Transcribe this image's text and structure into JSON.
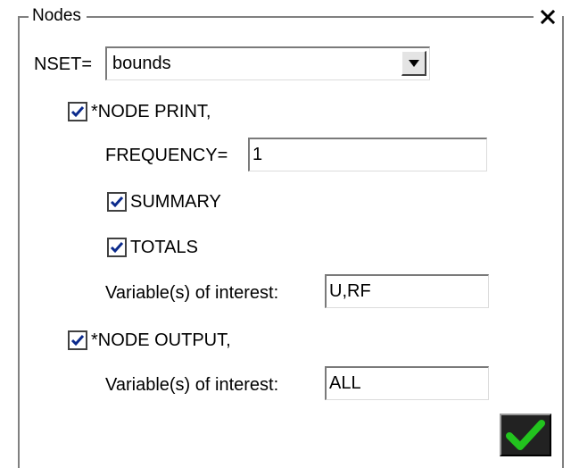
{
  "panel": {
    "title": "Nodes",
    "close_icon": "close-icon"
  },
  "nset": {
    "label": "NSET=",
    "value": "bounds",
    "dropdown_icon": "chevron-down-icon"
  },
  "node_print": {
    "checked": true,
    "label": "*NODE PRINT,",
    "frequency_label": "FREQUENCY=",
    "frequency_value": "1",
    "summary": {
      "checked": true,
      "label": "SUMMARY"
    },
    "totals": {
      "checked": true,
      "label": "TOTALS"
    },
    "variables_label": "Variable(s) of interest:",
    "variables_value": "U,RF"
  },
  "node_output": {
    "checked": true,
    "label": "*NODE OUTPUT,",
    "variables_label": "Variable(s) of interest:",
    "variables_value": "ALL"
  },
  "ok_button": {
    "icon": "checkmark-icon",
    "icon_color": "#22c31e"
  },
  "colors": {
    "checkmark": "#0b2a8c",
    "frame": "#808080"
  }
}
